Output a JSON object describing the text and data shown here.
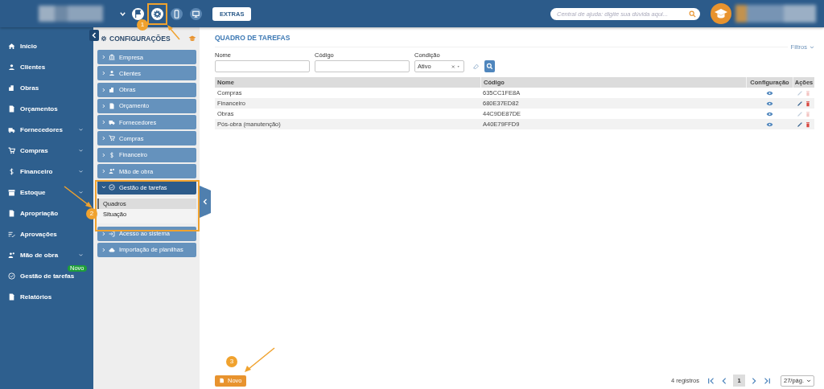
{
  "topbar": {
    "extras_button": "EXTRAS",
    "search": {
      "placeholder": "Central de ajuda: digite sua dúvida aqui..."
    }
  },
  "sidebar": {
    "items": [
      {
        "label": "Início",
        "has_submenu": false
      },
      {
        "label": "Clientes",
        "has_submenu": false
      },
      {
        "label": "Obras",
        "has_submenu": false
      },
      {
        "label": "Orçamentos",
        "has_submenu": false
      },
      {
        "label": "Fornecedores",
        "has_submenu": true
      },
      {
        "label": "Compras",
        "has_submenu": true
      },
      {
        "label": "Financeiro",
        "has_submenu": true
      },
      {
        "label": "Estoque",
        "has_submenu": true
      },
      {
        "label": "Apropriação",
        "has_submenu": false
      },
      {
        "label": "Aprovações",
        "has_submenu": false
      },
      {
        "label": "Mão de obra",
        "has_submenu": true
      },
      {
        "label": "Gestão de tarefas",
        "has_submenu": false,
        "badge": "Novo"
      },
      {
        "label": "Relatórios",
        "has_submenu": false
      }
    ]
  },
  "config_panel": {
    "title": "CONFIGURAÇÕES",
    "items": [
      {
        "label": "Empresa",
        "expanded": false
      },
      {
        "label": "Clientes",
        "expanded": false
      },
      {
        "label": "Obras",
        "expanded": false
      },
      {
        "label": "Orçamento",
        "expanded": false
      },
      {
        "label": "Fornecedores",
        "expanded": false
      },
      {
        "label": "Compras",
        "expanded": false
      },
      {
        "label": "Financeiro",
        "expanded": false
      },
      {
        "label": "Mão de obra",
        "expanded": false
      },
      {
        "label": "Gestão de tarefas",
        "expanded": true,
        "children": [
          {
            "label": "Quadros",
            "selected": true
          },
          {
            "label": "Situação",
            "selected": false
          }
        ]
      },
      {
        "label": "Acesso ao sistema",
        "expanded": false
      },
      {
        "label": "Importação de planilhas",
        "expanded": false
      }
    ]
  },
  "main": {
    "title": "QUADRO DE TAREFAS",
    "filters_toggle": "Filtros",
    "filters": [
      {
        "label": "Nome",
        "kind": "text"
      },
      {
        "label": "Código",
        "kind": "text"
      },
      {
        "label": "Condição",
        "kind": "select",
        "value": "Ativo"
      }
    ],
    "table": {
      "columns": [
        "Nome",
        "Código",
        "Configuração",
        "Ações"
      ],
      "rows": [
        {
          "name": "Compras",
          "code": "635CC1FE8A",
          "actions_enabled": false
        },
        {
          "name": "Financeiro",
          "code": "680E37ED82",
          "actions_enabled": true
        },
        {
          "name": "Obras",
          "code": "44C9DE87DE",
          "actions_enabled": false
        },
        {
          "name": "Pós-obra (manutenção)",
          "code": "A40E79FFD9",
          "actions_enabled": true
        }
      ]
    },
    "new_button": "Novo",
    "record_count": "4 registros",
    "current_page": "1",
    "page_size": "27/pág."
  },
  "annotations": [
    {
      "number": "1"
    },
    {
      "number": "2"
    },
    {
      "number": "3"
    }
  ]
}
